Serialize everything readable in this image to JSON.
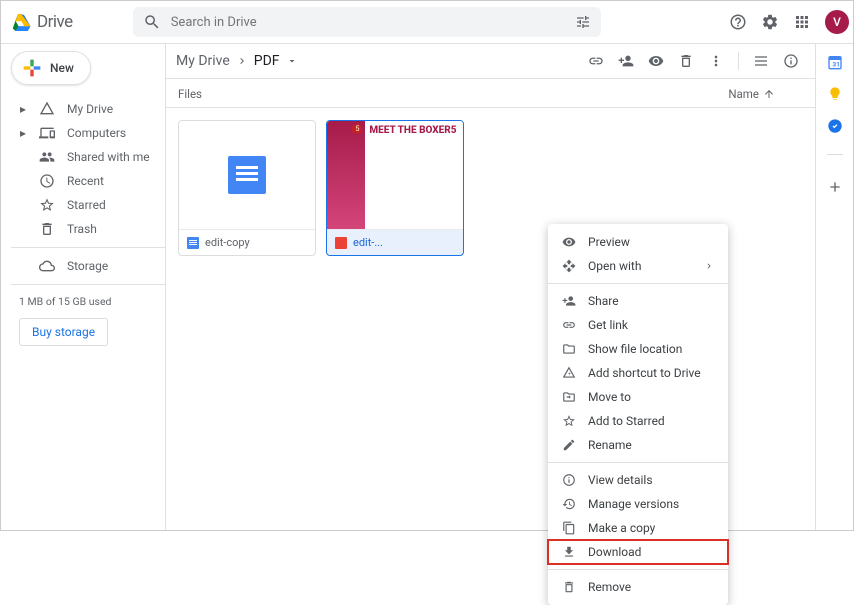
{
  "app": {
    "name": "Drive"
  },
  "search": {
    "placeholder": "Search in Drive"
  },
  "avatar_letter": "V",
  "new_button": "New",
  "nav": {
    "my_drive": "My Drive",
    "computers": "Computers",
    "shared": "Shared with me",
    "recent": "Recent",
    "starred": "Starred",
    "trash": "Trash",
    "storage": "Storage",
    "usage": "1 MB of 15 GB used",
    "buy": "Buy storage"
  },
  "breadcrumb": {
    "root": "My Drive",
    "current": "PDF"
  },
  "list_header": {
    "files": "Files",
    "name": "Name"
  },
  "files": [
    {
      "name": "edit-copy",
      "type": "doc"
    },
    {
      "name": "edit-...",
      "type": "pdf",
      "thumb_title": "MEET THE BOXER5"
    }
  ],
  "menu": {
    "preview": "Preview",
    "open_with": "Open with",
    "share": "Share",
    "get_link": "Get link",
    "show_location": "Show file location",
    "add_shortcut": "Add shortcut to Drive",
    "move_to": "Move to",
    "add_starred": "Add to Starred",
    "rename": "Rename",
    "view_details": "View details",
    "manage_versions": "Manage versions",
    "make_copy": "Make a copy",
    "download": "Download",
    "remove": "Remove"
  }
}
